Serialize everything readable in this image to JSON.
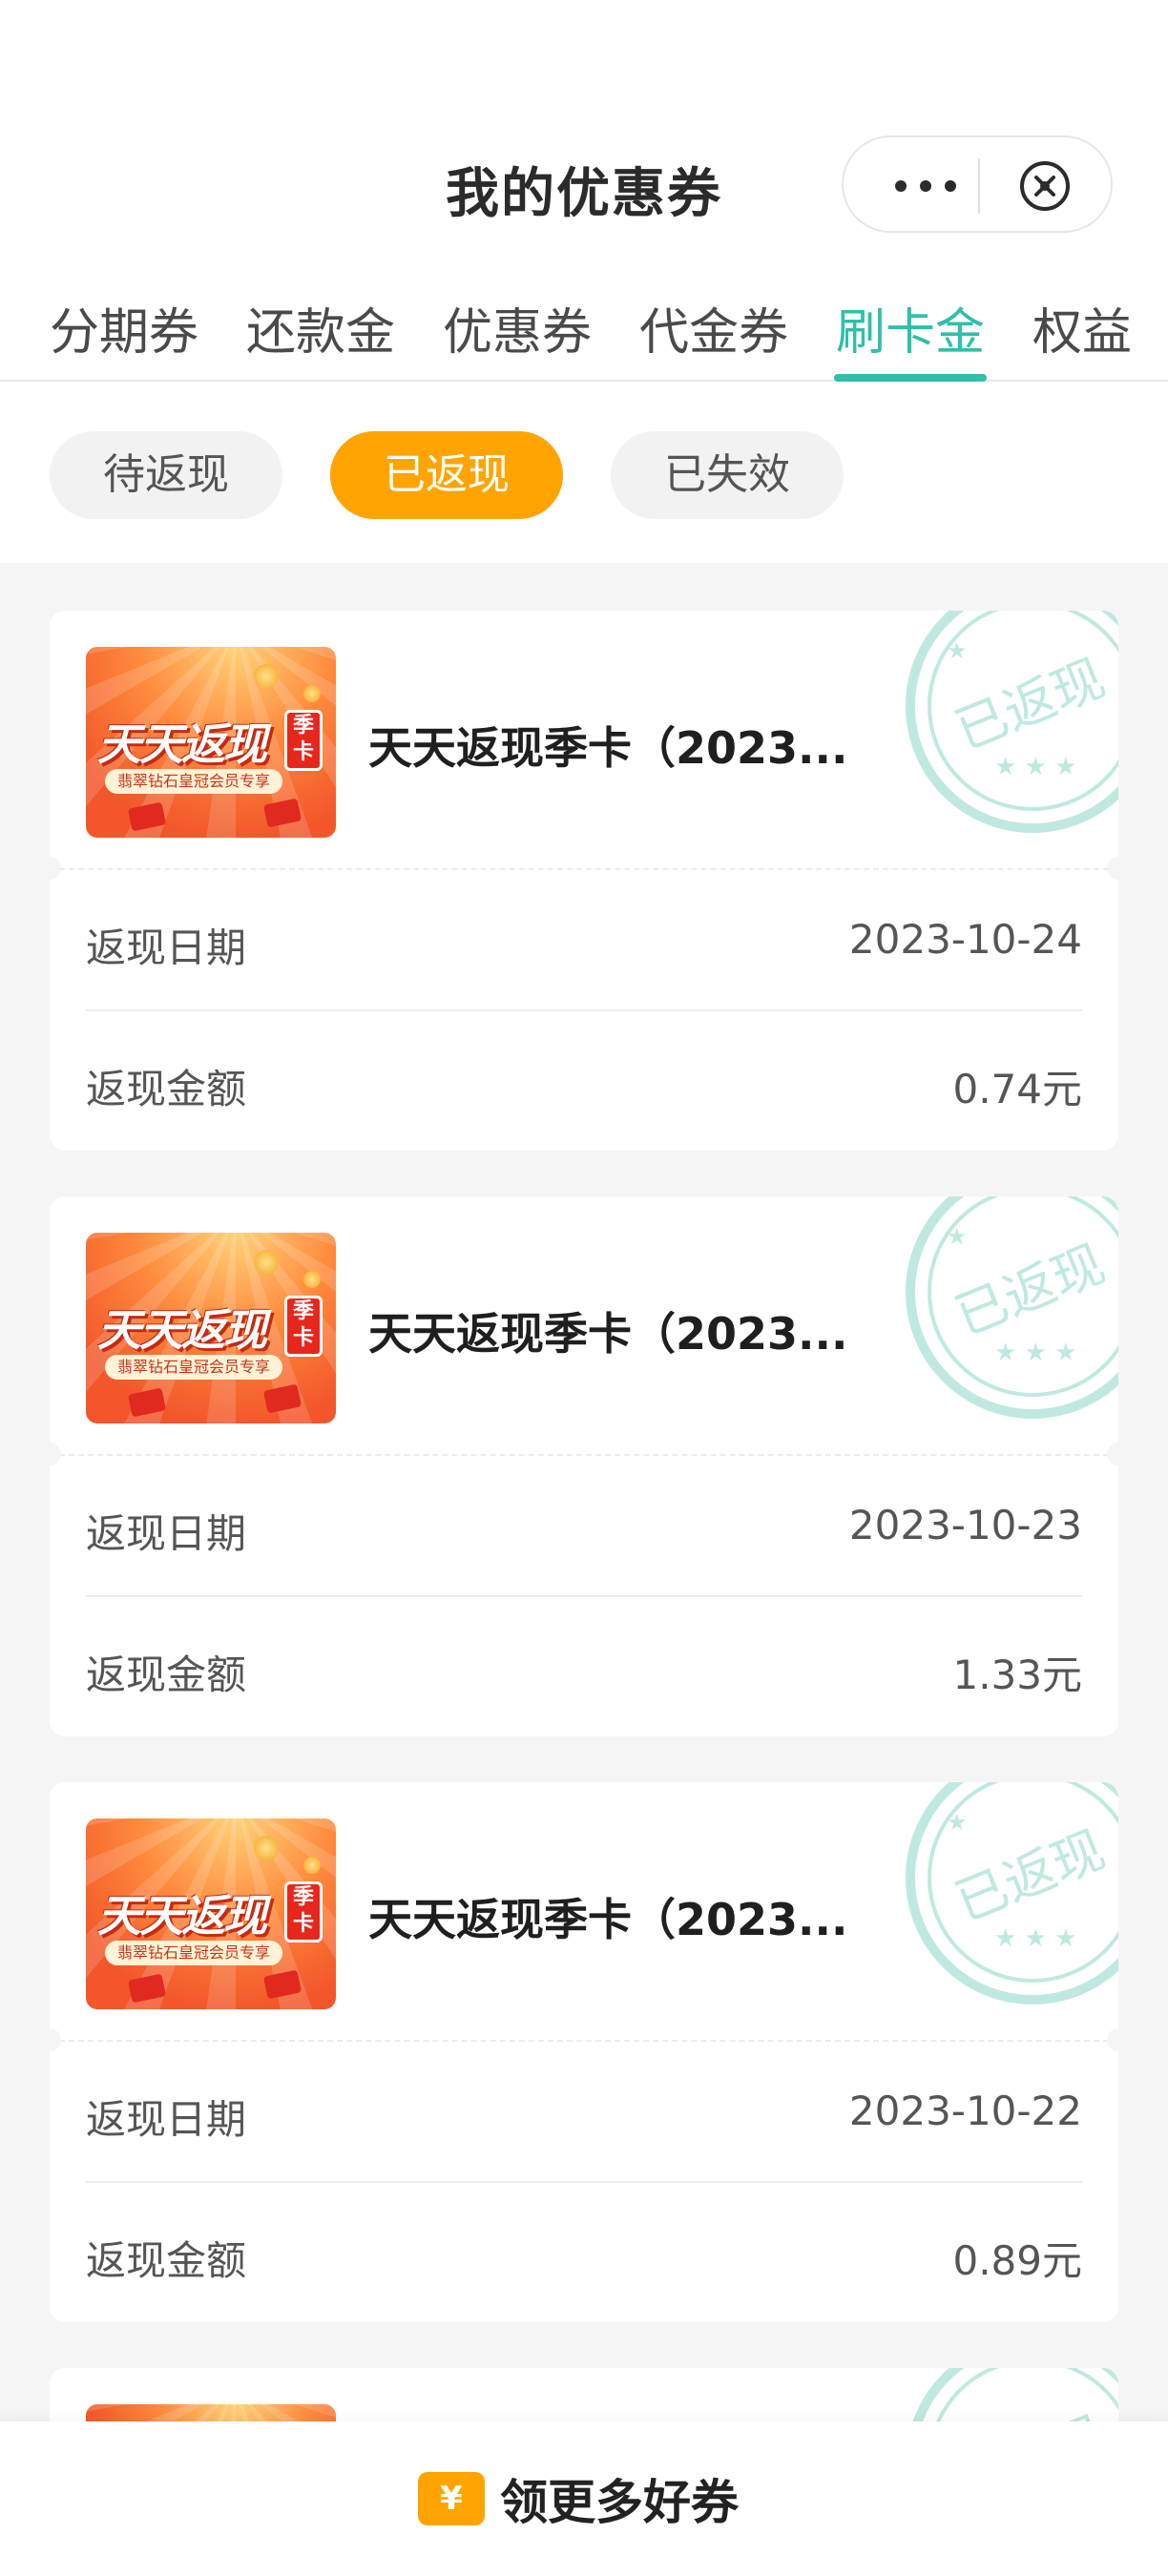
{
  "header": {
    "title": "我的优惠券"
  },
  "tabs": [
    {
      "label": "分期券",
      "active": false
    },
    {
      "label": "还款金",
      "active": false
    },
    {
      "label": "优惠券",
      "active": false
    },
    {
      "label": "代金券",
      "active": false
    },
    {
      "label": "刷卡金",
      "active": true
    },
    {
      "label": "权益",
      "active": false
    }
  ],
  "filters": [
    {
      "label": "待返现",
      "active": false
    },
    {
      "label": "已返现",
      "active": true
    },
    {
      "label": "已失效",
      "active": false
    }
  ],
  "thumbnail": {
    "main_text": "天天返现",
    "badge_text": "季卡",
    "sub_text": "翡翠钻石皇冠会员专享"
  },
  "stamp_text": "已返现",
  "cards": [
    {
      "name": "天天返现季卡（2023...",
      "date_label": "返现日期",
      "date": "2023-10-24",
      "amount_label": "返现金额",
      "amount": "0.74元"
    },
    {
      "name": "天天返现季卡（2023...",
      "date_label": "返现日期",
      "date": "2023-10-23",
      "amount_label": "返现金额",
      "amount": "1.33元"
    },
    {
      "name": "天天返现季卡（2023...",
      "date_label": "返现日期",
      "date": "2023-10-22",
      "amount_label": "返现金额",
      "amount": "0.89元"
    }
  ],
  "bottom": {
    "icon_symbol": "¥",
    "label": "领更多好券"
  },
  "colors": {
    "accent": "#2fbfaa",
    "active_pill": "#ffa400",
    "stamp": "#bfe9e0"
  }
}
